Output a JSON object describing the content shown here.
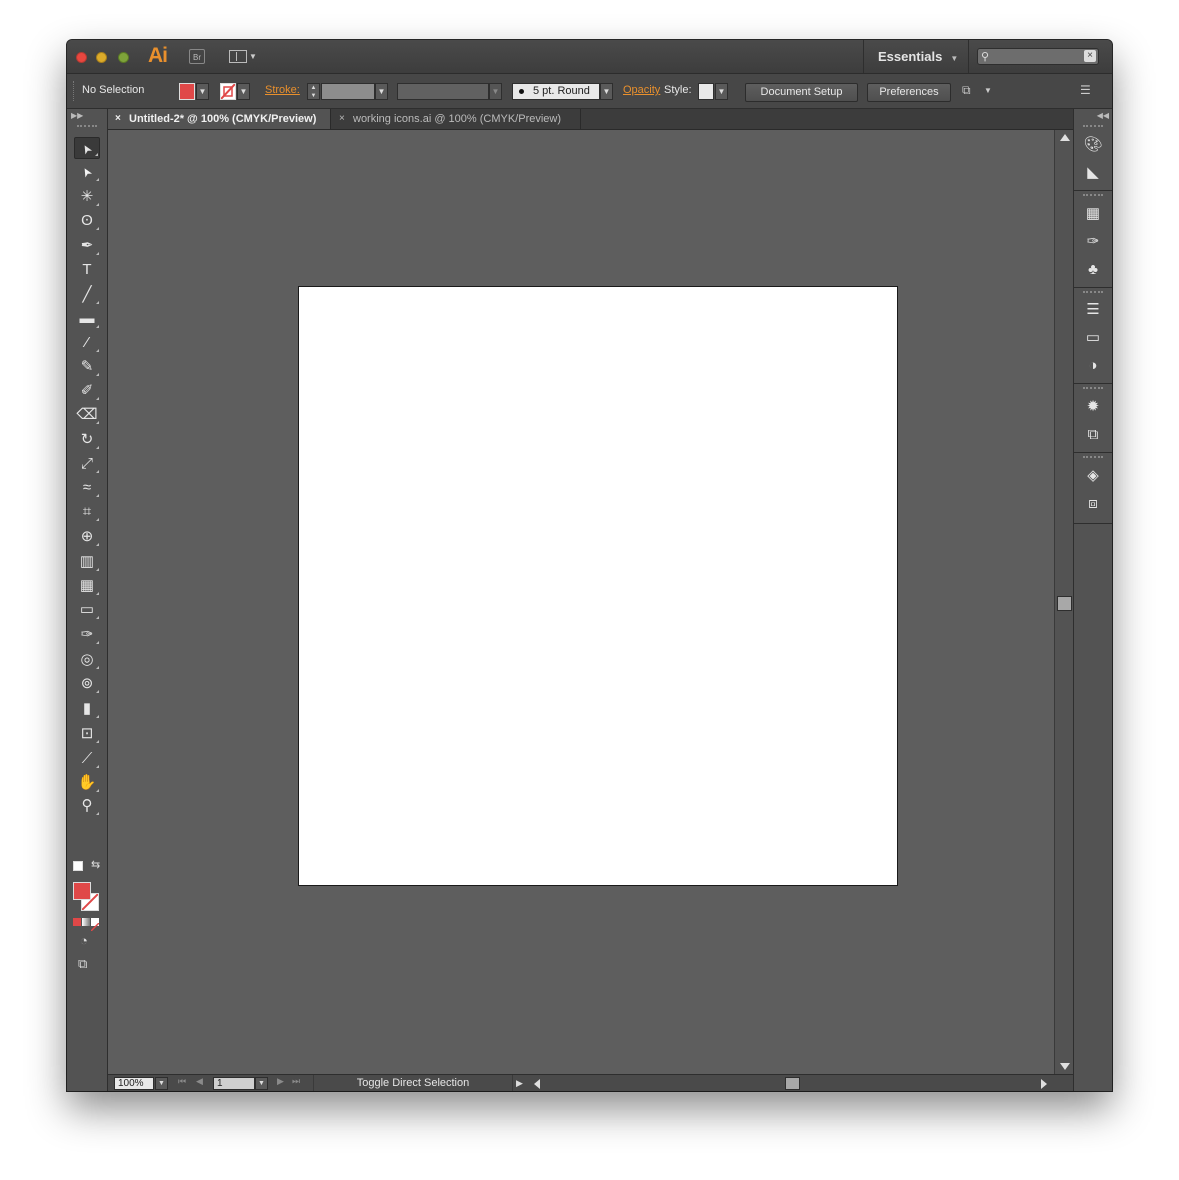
{
  "app": {
    "logo": "Ai",
    "bridge_label": "Br",
    "workspace": "Essentials",
    "search_placeholder": ""
  },
  "controlbar": {
    "selection": "No Selection",
    "stroke_label": "Stroke:",
    "brush_label": "5 pt. Round",
    "opacity_label": "Opacity",
    "style_label": "Style:",
    "document_setup": "Document Setup",
    "preferences": "Preferences",
    "fill_color": "#e04848"
  },
  "tabs": [
    {
      "label": "Untitled-2* @ 100% (CMYK/Preview)",
      "active": true
    },
    {
      "label": "working icons.ai @ 100% (CMYK/Preview)",
      "active": false
    }
  ],
  "tools": [
    {
      "name": "selection-tool",
      "glyph": "➤"
    },
    {
      "name": "direct-selection-tool",
      "glyph": "➤"
    },
    {
      "name": "magic-wand-tool",
      "glyph": "✳"
    },
    {
      "name": "lasso-tool",
      "glyph": "ʘ"
    },
    {
      "name": "pen-tool",
      "glyph": "✒"
    },
    {
      "name": "type-tool",
      "glyph": "T"
    },
    {
      "name": "line-segment-tool",
      "glyph": "╱"
    },
    {
      "name": "rectangle-tool",
      "glyph": "▬"
    },
    {
      "name": "paintbrush-tool",
      "glyph": "⁄"
    },
    {
      "name": "pencil-tool",
      "glyph": "✎"
    },
    {
      "name": "blob-brush-tool",
      "glyph": "✐"
    },
    {
      "name": "eraser-tool",
      "glyph": "⌫"
    },
    {
      "name": "rotate-tool",
      "glyph": "↻"
    },
    {
      "name": "scale-tool",
      "glyph": "⤢"
    },
    {
      "name": "width-tool",
      "glyph": "≈"
    },
    {
      "name": "free-transform-tool",
      "glyph": "⌗"
    },
    {
      "name": "shape-builder-tool",
      "glyph": "⊕"
    },
    {
      "name": "perspective-grid-tool",
      "glyph": "▥"
    },
    {
      "name": "mesh-tool",
      "glyph": "▦"
    },
    {
      "name": "gradient-tool",
      "glyph": "▭"
    },
    {
      "name": "eyedropper-tool",
      "glyph": "✑"
    },
    {
      "name": "blend-tool",
      "glyph": "◎"
    },
    {
      "name": "symbol-sprayer-tool",
      "glyph": "⊚"
    },
    {
      "name": "column-graph-tool",
      "glyph": "▮"
    },
    {
      "name": "artboard-tool",
      "glyph": "⊡"
    },
    {
      "name": "slice-tool",
      "glyph": "⟋"
    },
    {
      "name": "hand-tool",
      "glyph": "✋"
    },
    {
      "name": "zoom-tool",
      "glyph": "⚲"
    }
  ],
  "status": {
    "zoom": "100%",
    "page": "1",
    "text": "Toggle Direct Selection"
  }
}
